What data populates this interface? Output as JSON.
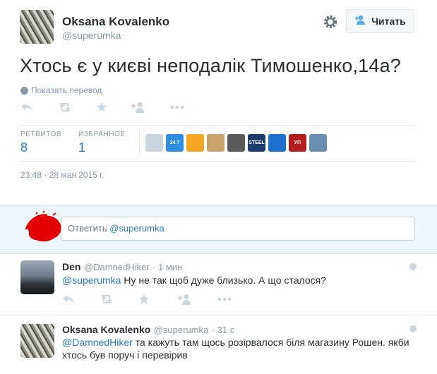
{
  "tweet": {
    "author_name": "Oksana Kovalenko",
    "author_handle": "@superumka",
    "follow_label": "Читать",
    "text": "Хтось є у києві неподалік Тимошенко,14а?",
    "translate_label": "Показать перевод",
    "stats": {
      "retweets_label": "РЕТВИТОВ",
      "retweets_value": "8",
      "favorites_label": "ИЗБРАННОЕ",
      "favorites_value": "1"
    },
    "favoriters": [
      {
        "icon": "map-avatar",
        "color": "#c9d4dd"
      },
      {
        "icon": "news-247-avatar",
        "color": "#2f8ee0",
        "text": "24 7"
      },
      {
        "icon": "orange-egg-avatar",
        "color": "#f5a623"
      },
      {
        "icon": "woman-avatar",
        "color": "#c8a26a"
      },
      {
        "icon": "collage-avatar",
        "color": "#5b5b5b"
      },
      {
        "icon": "steel-avatar",
        "color": "#1d3c6e",
        "text": "STEEL"
      },
      {
        "icon": "blue-logo-avatar",
        "color": "#1f6fd1"
      },
      {
        "icon": "up-avatar",
        "color": "#b21e1e",
        "text": "УП"
      },
      {
        "icon": "crowd-avatar",
        "color": "#6a8fb0"
      }
    ],
    "timestamp": "23:48 - 28 мая 2015 г."
  },
  "reply_box": {
    "prefix": "Ответить",
    "mention": "@superumka"
  },
  "comments": [
    {
      "name": "Den",
      "handle": "@DamnedHiker",
      "time": "1 мин",
      "mention": "@superumka",
      "text": "Ну не так щоб дуже близько. А що сталося?"
    },
    {
      "name": "Oksana Kovalenko",
      "handle": "@superumka",
      "time": "31 с",
      "mention": "@DamnedHiker",
      "text": "та кажуть там щось розірвалося біля магазину Рошен. якби хтось був поруч і перевірив"
    }
  ],
  "colors": {
    "link": "#2b7bb9",
    "muted": "#8899a6",
    "action_icon": "#ccd6dd",
    "reply_bg": "#edf5fb",
    "scribble": "#e00000"
  }
}
